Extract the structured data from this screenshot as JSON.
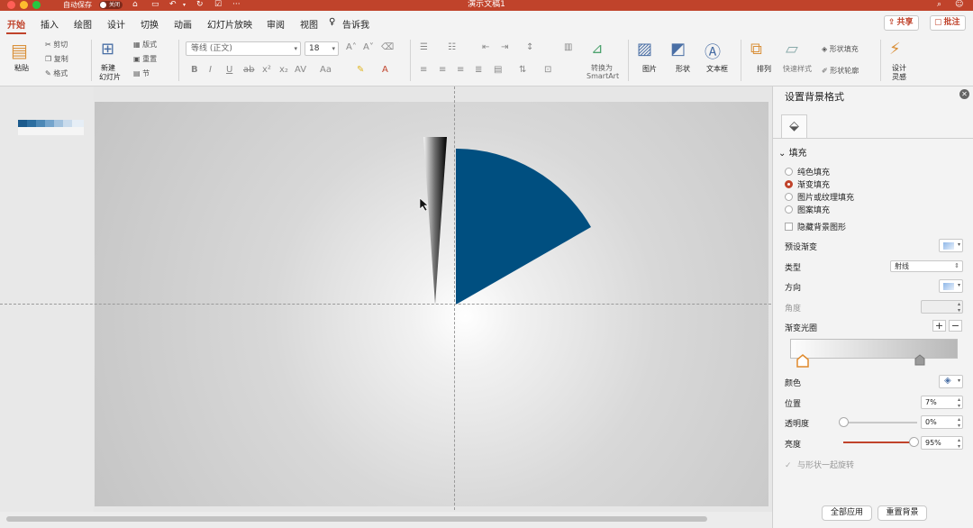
{
  "window": {
    "autosave_label": "自动保存",
    "autosave_state": "关闭",
    "doc_title": "演示文稿1"
  },
  "tabs": [
    "开始",
    "插入",
    "绘图",
    "设计",
    "切换",
    "动画",
    "幻灯片放映",
    "审阅",
    "视图"
  ],
  "tell_me": "告诉我",
  "header_buttons": {
    "share": "共享",
    "comment": "批注"
  },
  "ribbon": {
    "paste": "粘贴",
    "cut": "剪切",
    "copy": "复制",
    "format": "格式",
    "new_slide_line1": "新建",
    "new_slide_line2": "幻灯片",
    "layout": "版式",
    "reset": "重置",
    "section": "节",
    "font_name": "等线 (正文)",
    "font_size": "18",
    "convert_line1": "转换为",
    "convert_line2": "SmartArt",
    "picture": "图片",
    "shape": "形状",
    "textbox": "文本框",
    "arrange": "排列",
    "quick_styles": "快速样式",
    "shape_fill": "形状填充",
    "shape_outline": "形状轮廓",
    "designer_line1": "设计",
    "designer_line2": "灵感"
  },
  "panel": {
    "title": "设置背景格式",
    "section_fill": "填充",
    "fill_options": [
      {
        "label": "纯色填充",
        "selected": false
      },
      {
        "label": "渐变填充",
        "selected": true
      },
      {
        "label": "图片或纹理填充",
        "selected": false
      },
      {
        "label": "图案填充",
        "selected": false
      }
    ],
    "hide_bg_graphics": "隐藏背景图形",
    "preset_gradient": "预设渐变",
    "type_label": "类型",
    "type_value": "射线",
    "direction_label": "方向",
    "angle_label": "角度",
    "gradient_stops_label": "渐变光圈",
    "color_label": "颜色",
    "position_label": "位置",
    "position_value": "7%",
    "transparency_label": "透明度",
    "transparency_value": "0%",
    "transparency_level": 0,
    "brightness_label": "亮度",
    "brightness_value": "95%",
    "brightness_level": 0.95,
    "rotate_with_shape": "与形状一起旋转",
    "apply_all": "全部应用",
    "reset_bg": "重置背景"
  },
  "colors": {
    "accent": "#c0432b",
    "wedge_blue": "#004f80"
  }
}
